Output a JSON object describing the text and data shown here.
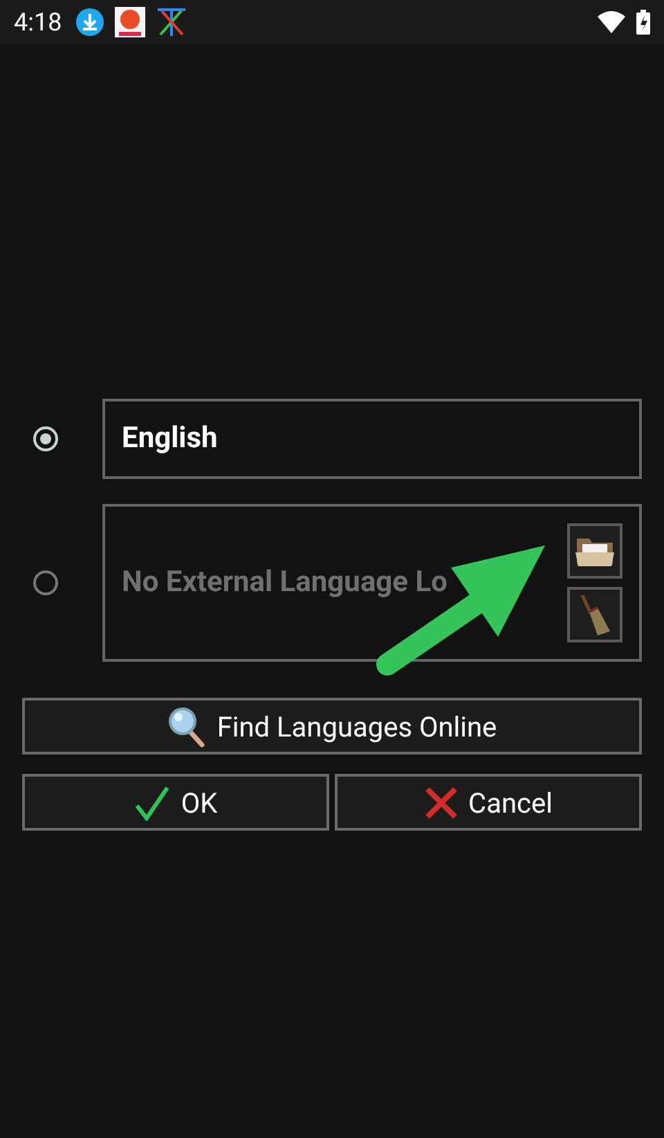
{
  "status_bar": {
    "time": "4:18"
  },
  "languages": [
    {
      "kind": "plain",
      "label": "English",
      "selected": true
    },
    {
      "kind": "external",
      "label": "No External Language Lo",
      "selected": false
    }
  ],
  "buttons": [
    {
      "kind": "search",
      "label": "Find Languages Online"
    },
    {
      "kind": "ok",
      "label": "OK"
    },
    {
      "kind": "cancel",
      "label": "Cancel"
    }
  ]
}
